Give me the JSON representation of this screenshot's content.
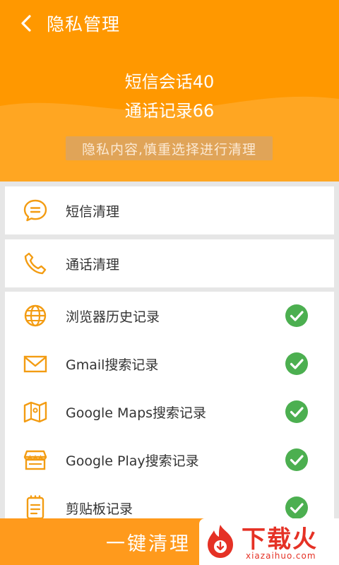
{
  "header": {
    "title": "隐私管理",
    "sms_stat": "短信会话40",
    "call_stat": "通话记录66",
    "notice": "隐私内容,慎重选择进行清理"
  },
  "cleanup": {
    "sms": "短信清理",
    "calls": "通话清理"
  },
  "records": [
    {
      "label": "浏览器历史记录",
      "icon": "globe-icon",
      "checked": true
    },
    {
      "label": "Gmail搜索记录",
      "icon": "mail-icon",
      "checked": true
    },
    {
      "label": "Google Maps搜索记录",
      "icon": "map-icon",
      "checked": true
    },
    {
      "label": "Google Play搜索记录",
      "icon": "store-icon",
      "checked": true
    },
    {
      "label": "剪贴板记录",
      "icon": "clipboard-icon",
      "checked": true
    }
  ],
  "footer": {
    "clean_button": "一键清理"
  },
  "watermark": {
    "brand": "下载火",
    "url": "xiazaihuo.com"
  },
  "colors": {
    "accent": "#ff9800",
    "check": "#4caf50",
    "icon": "#f39c12"
  }
}
